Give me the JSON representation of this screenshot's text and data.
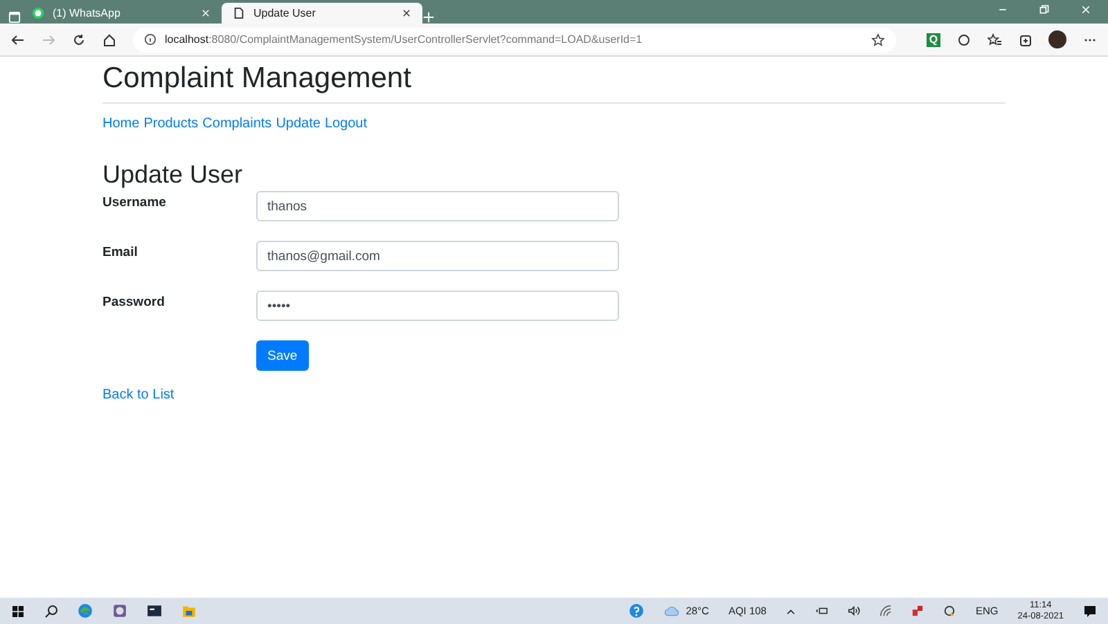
{
  "browser": {
    "tabs": [
      {
        "title": "(1) WhatsApp",
        "kind": "whatsapp",
        "selected": false
      },
      {
        "title": "Update User",
        "kind": "page",
        "selected": true
      }
    ],
    "address": {
      "host": "localhost",
      "path": ":8080/ComplaintManagementSystem/UserControllerServlet?command=LOAD&userId=1"
    },
    "extension_label": "Q"
  },
  "page": {
    "title": "Complaint Management",
    "nav": [
      "Home",
      "Products",
      "Complaints",
      "Update",
      "Logout"
    ],
    "heading": "Update User",
    "fields": [
      {
        "label": "Username",
        "value": "thanos"
      },
      {
        "label": "Email",
        "value": "thanos@gmail.com"
      },
      {
        "label": "Password",
        "value": "•••••"
      }
    ],
    "save": "Save",
    "back": "Back to List"
  },
  "taskbar": {
    "temperature": "28°C",
    "aqi": "AQI 108",
    "language": "ENG",
    "time": "11:14",
    "date": "24-08-2021"
  }
}
